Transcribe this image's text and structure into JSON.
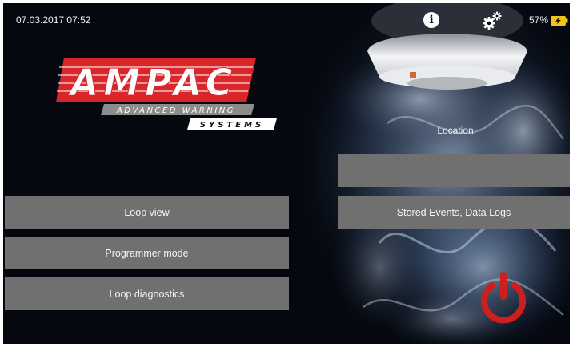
{
  "status_bar": {
    "datetime": "07.03.2017 07:52",
    "battery_percent": "57%",
    "icons": [
      "info-icon",
      "gear-icon",
      "battery-charging-icon"
    ]
  },
  "logo": {
    "brand": "AMPAC",
    "tagline_1": "ADVANCED WARNING",
    "tagline_2": "SYSTEMS"
  },
  "location": {
    "label": "Location",
    "value": ""
  },
  "menu_left": {
    "loop_view": "Loop view",
    "programmer_mode": "Programmer mode",
    "loop_diagnostics": "Loop diagnostics"
  },
  "menu_right": {
    "stored_events": "Stored Events, Data Logs"
  },
  "power_button_icon": "power-icon",
  "colors": {
    "background": "#05080f",
    "button": "#707070",
    "brand_red": "#d8262b",
    "power_red": "#cc1f1f",
    "battery_yellow": "#f2c511"
  }
}
